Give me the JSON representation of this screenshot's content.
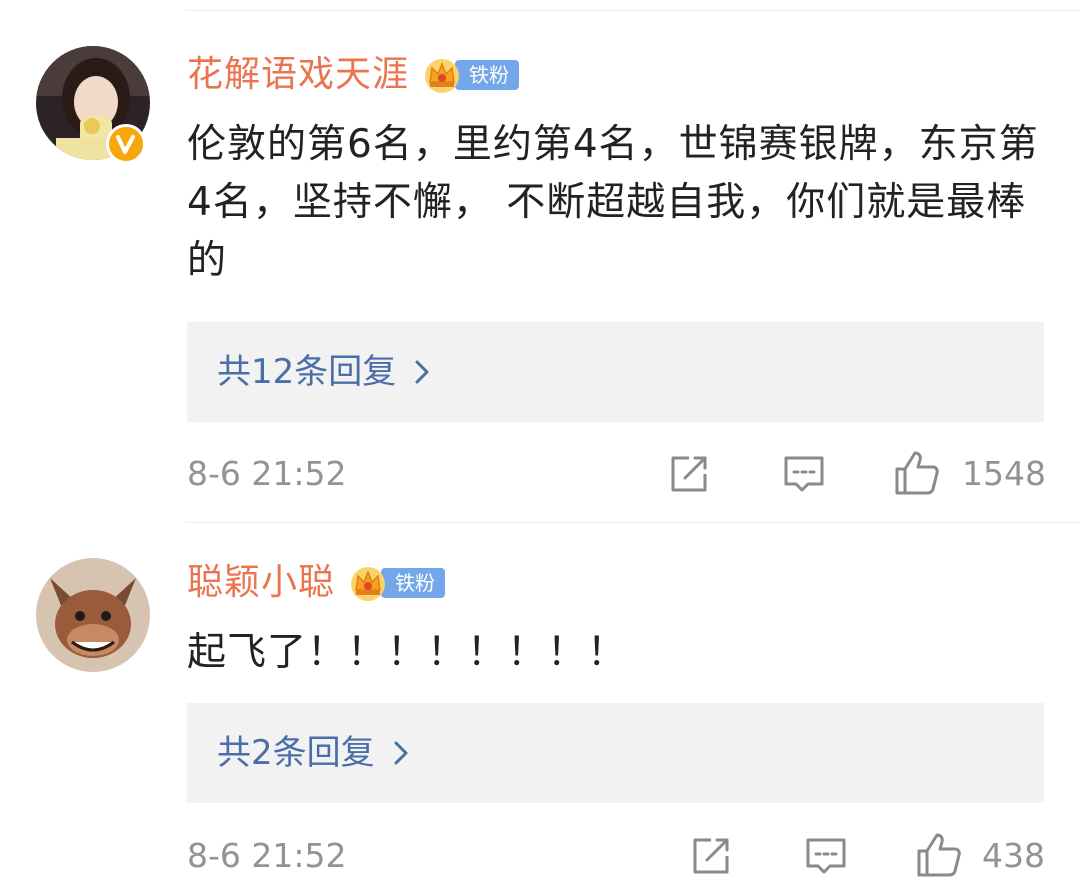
{
  "comments": [
    {
      "username": "花解语戏天涯",
      "badge_label": "铁粉",
      "text": "伦敦的第6名，里约第4名，世锦赛银牌，东京第4名，坚持不懈， 不断超越自我，你们就是最棒的",
      "replies_label": "共12条回复",
      "time": "8-6 21:52",
      "likes": "1548"
    },
    {
      "username": "聪颖小聪",
      "badge_label": "铁粉",
      "text": "起飞了！！！！！！！！",
      "replies_label": "共2条回复",
      "time": "8-6 21:52",
      "likes": "438"
    }
  ],
  "colors": {
    "username": "#eb7350",
    "fan_badge": "#73a7e9",
    "reply_link": "#4b6ea8",
    "meta_gray": "#939393",
    "verified": "#f7a70a"
  },
  "icons": [
    "verified-v-icon",
    "crown-icon",
    "chevron-right-icon",
    "share-icon",
    "comment-icon",
    "like-icon"
  ]
}
